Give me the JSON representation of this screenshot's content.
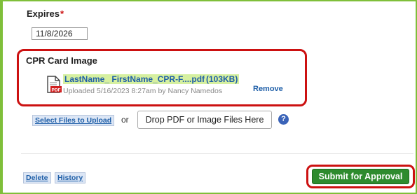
{
  "expires": {
    "label": "Expires",
    "required_mark": "*",
    "value": "11/8/2026"
  },
  "cpr_card": {
    "label": "CPR Card Image",
    "file_icon": "pdf-file-icon",
    "file_name": "LastName_ FirstName_CPR-F....pdf",
    "file_size": "(103KB)",
    "upload_info": "Uploaded 5/16/2023 8:27am by Nancy Namedos",
    "remove_label": "Remove"
  },
  "upload": {
    "select_files_label": "Select Files to Upload",
    "or_text": "or",
    "drop_zone_label": "Drop PDF or Image Files Here",
    "help_icon": "question-circle-icon",
    "help_glyph": "?"
  },
  "footer": {
    "delete_label": "Delete",
    "history_label": "History",
    "submit_label": "Submit for Approval"
  },
  "colors": {
    "frame_border": "#7fbf3a",
    "highlight_red": "#cc1111",
    "link_blue": "#1f5fa8",
    "file_highlight": "#d6f0a0",
    "submit_green": "#2e8b2e"
  }
}
